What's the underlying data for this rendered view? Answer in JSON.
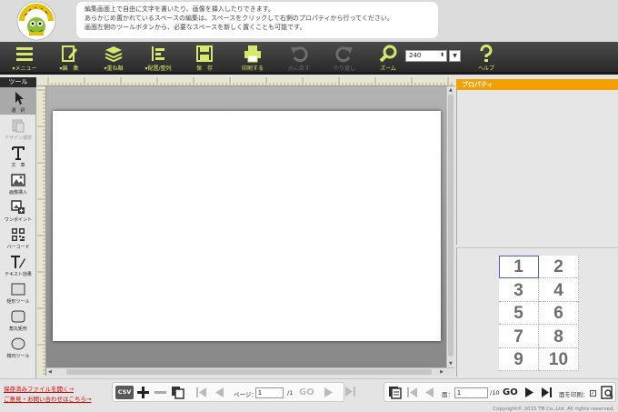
{
  "banner": {
    "help_lines": [
      "編集画面上で自由に文字を書いたり、画像を挿入したりできます。",
      "あらかじめ置かれているスペースの編集は、スペースをクリックして右側のプロパティから行ってください。",
      "画面左側のツールボタンから、必要なスペースを新しく置くことも可能です。"
    ]
  },
  "toolbar": {
    "menu": "▾メニュー",
    "edit": "▾編　集",
    "layer": "▾重ね順",
    "align": "▾配置/整列",
    "save": "保　存",
    "print": "印刷する",
    "undo": "元に戻す",
    "redo": "やり直し",
    "zoom": "ズーム",
    "zoom_value": "240",
    "help": "ヘルプ"
  },
  "tools": {
    "header": "ツール",
    "items": [
      {
        "label": "選　択",
        "icon": "cursor-icon",
        "active": true,
        "disabled": false
      },
      {
        "label": "デザイン選択",
        "icon": "design-select-icon",
        "active": false,
        "disabled": true
      },
      {
        "label": "文　章",
        "icon": "text-icon",
        "active": false,
        "disabled": false
      },
      {
        "label": "画像挿入",
        "icon": "image-icon",
        "active": false,
        "disabled": false
      },
      {
        "label": "ワンポイント",
        "icon": "onepoint-icon",
        "active": false,
        "disabled": false
      },
      {
        "label": "バーコード",
        "icon": "barcode-icon",
        "active": false,
        "disabled": false
      },
      {
        "label": "テキスト効果",
        "icon": "text-effect-icon",
        "active": false,
        "disabled": false
      },
      {
        "label": "矩形ツール",
        "icon": "rectangle-icon",
        "active": false,
        "disabled": false
      },
      {
        "label": "角丸矩形",
        "icon": "rounded-rectangle-icon",
        "active": false,
        "disabled": false
      },
      {
        "label": "楕円ツール",
        "icon": "ellipse-icon",
        "active": false,
        "disabled": false
      }
    ]
  },
  "properties": {
    "header": "プロパティ"
  },
  "pages": {
    "numbers": [
      "1",
      "2",
      "3",
      "4",
      "5",
      "6",
      "7",
      "8",
      "9",
      "10"
    ],
    "selected": "1"
  },
  "bottom": {
    "link_open": "保存済みファイルを開く→",
    "link_contact": "ご意見・お問い合わせはこちら→",
    "csv": "CSV",
    "page_label": "ページ：",
    "page_value": "1",
    "page_total": "/1",
    "go": "GO",
    "sheet_label": "面：",
    "sheet_value": "1",
    "sheet_total": "/10",
    "print_sheet": "面を印刷：",
    "print_checked": "✓",
    "copyright": "Copyright© 2015 TB Co.,Ltd. All rights reserved."
  },
  "colors": {
    "accent_yellow": "#d8e86a",
    "prop_orange": "#f4a000",
    "link_red": "#d40000",
    "selection_blue": "#4a5fc9"
  }
}
